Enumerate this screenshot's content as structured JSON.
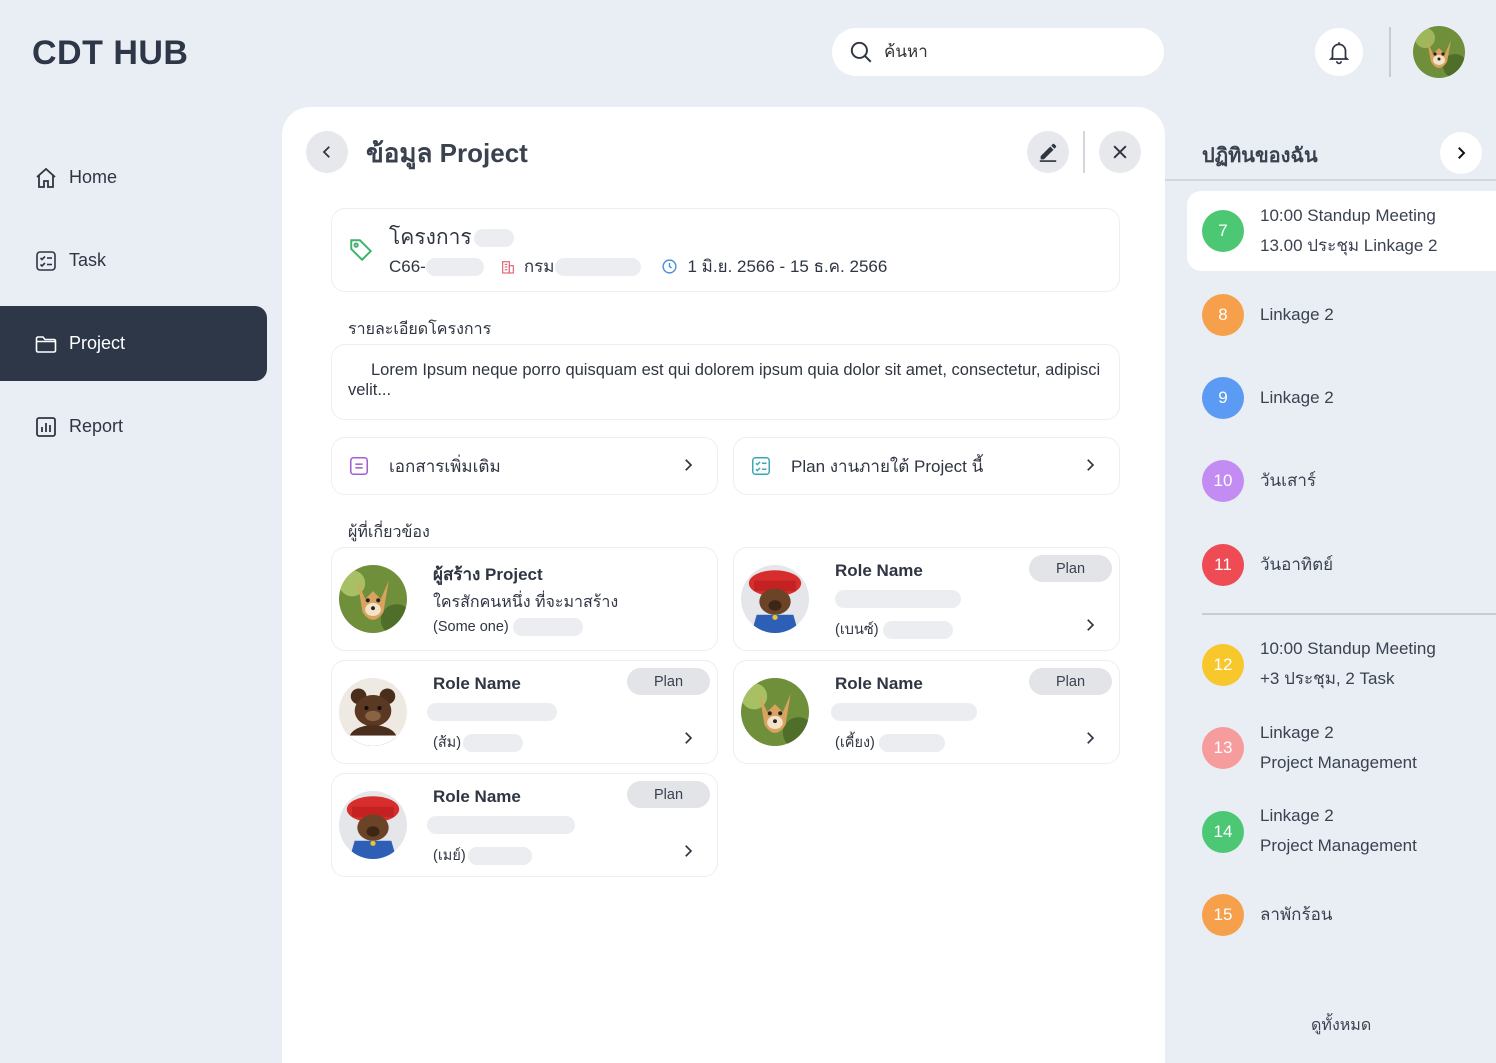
{
  "app": {
    "logo": "CDT HUB"
  },
  "search": {
    "placeholder": "ค้นหา"
  },
  "nav": {
    "items": [
      {
        "label": "Home",
        "icon": "home-icon"
      },
      {
        "label": "Task",
        "icon": "task-checklist-icon"
      },
      {
        "label": "Project",
        "icon": "folder-icon",
        "active": true
      },
      {
        "label": "Report",
        "icon": "bar-chart-icon"
      }
    ]
  },
  "project": {
    "title": "ข้อมูล Project",
    "name_prefix": "โครงการ",
    "code_prefix": "C66-",
    "dept_prefix": "กรม",
    "date_range": "1 มิ.ย. 2566 - 15 ธ.ค. 2566",
    "description_label": "รายละเอียดโครงการ",
    "description": "Lorem Ipsum neque porro quisquam est qui dolorem ipsum quia dolor sit amet, consectetur, adipisci velit...",
    "links": {
      "documents": "เอกสารเพิ่มเติม",
      "plan": "Plan งานภายใต้ Project นี้"
    },
    "people_label": "ผู้ที่เกี่ยวข้อง",
    "people": [
      {
        "name": "ผู้สร้าง Project",
        "sub": "ใครสักคนหนึ่ง ที่จะมาสร้าง",
        "nick": "(Some one)",
        "badge": "",
        "avatar": "dog"
      },
      {
        "name": "Role Name",
        "sub": "",
        "nick": "(เบนซ์)",
        "badge": "Plan",
        "avatar": "bear-hat"
      },
      {
        "name": "Role Name",
        "sub": "",
        "nick": "(ส้ม)",
        "badge": "Plan",
        "avatar": "teddy"
      },
      {
        "name": "Role Name",
        "sub": "",
        "nick": "(เคี้ยง)",
        "badge": "Plan",
        "avatar": "dog"
      },
      {
        "name": "Role Name",
        "sub": "",
        "nick": "(เมย์)",
        "badge": "Plan",
        "avatar": "bear-hat"
      }
    ]
  },
  "calendar": {
    "title": "ปฏิทินของฉัน",
    "days": [
      {
        "day": "7",
        "color": "#4cc774",
        "lines": [
          "10:00  Standup Meeting",
          "13.00  ประชุม Linkage 2"
        ],
        "today": true
      },
      {
        "day": "8",
        "color": "#f7a04b",
        "lines": [
          "Linkage 2"
        ]
      },
      {
        "day": "9",
        "color": "#5b9bf3",
        "lines": [
          "Linkage 2"
        ]
      },
      {
        "day": "10",
        "color": "#c38cf2",
        "lines": [
          "วันเสาร์"
        ]
      },
      {
        "day": "11",
        "color": "#ee4b54",
        "lines": [
          "วันอาทิตย์"
        ]
      },
      {
        "day": "12",
        "color": "#f7c72c",
        "lines": [
          "10:00  Standup Meeting",
          "+3 ประชุม, 2 Task"
        ]
      },
      {
        "day": "13",
        "color": "#f79c9c",
        "lines": [
          "Linkage 2",
          "Project Management"
        ]
      },
      {
        "day": "14",
        "color": "#4cc774",
        "lines": [
          "Linkage 2",
          "Project Management"
        ]
      },
      {
        "day": "15",
        "color": "#f7a04b",
        "lines": [
          "ลาพักร้อน"
        ]
      }
    ],
    "view_all": "ดูทั้งหมด"
  },
  "colors": {
    "nav_active": "#2d3748",
    "page_bg": "#e9eef5",
    "tag_green": "#3db36b",
    "clock_blue": "#4a90d9"
  }
}
